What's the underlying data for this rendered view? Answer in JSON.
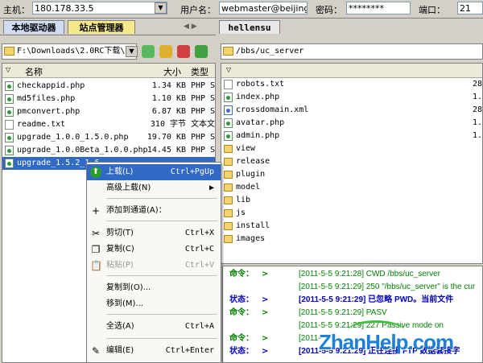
{
  "connection": {
    "host_label": "主机：",
    "host_value": "180.178.33.5",
    "user_label": "用户名：",
    "user_value": "webmaster@beijingn",
    "pass_label": "密码：",
    "pass_value": "********",
    "port_label": "端口：",
    "port_value": "21"
  },
  "tabs": {
    "local": "本地驱动器",
    "site_manager": "站点管理器",
    "remote": "hellensu"
  },
  "local_pane": {
    "path": "F:\\Downloads\\2.0RC下载\\U",
    "columns": {
      "name": "名称",
      "size": "大小",
      "type": "类型"
    },
    "files": [
      {
        "name": "checkappid.php",
        "size": "1.34 KB",
        "type": "PHP S",
        "icon": "php-file-icon"
      },
      {
        "name": "md5files.php",
        "size": "1.10 KB",
        "type": "PHP S",
        "icon": "php-file-icon"
      },
      {
        "name": "pmconvert.php",
        "size": "6.87 KB",
        "type": "PHP S",
        "icon": "php-file-icon"
      },
      {
        "name": "readme.txt",
        "size": "310 字节",
        "type": "文本文",
        "icon": "text-file-icon"
      },
      {
        "name": "upgrade_1.0.0_1.5.0.php",
        "size": "19.70 KB",
        "type": "PHP S",
        "icon": "php-file-icon"
      },
      {
        "name": "upgrade_1.0.0Beta_1.0.0.php",
        "size": "14.45 KB",
        "type": "PHP S",
        "icon": "php-file-icon"
      },
      {
        "name": "upgrade_1.5.2_1.6",
        "size": "",
        "type": "",
        "icon": "php-file-icon"
      }
    ]
  },
  "remote_pane": {
    "path": "/bbs/uc_server",
    "files": [
      {
        "name": "robots.txt",
        "size": "28",
        "icon": "text-file-icon"
      },
      {
        "name": "index.php",
        "size": "1.",
        "icon": "php-file-icon"
      },
      {
        "name": "crossdomain.xml",
        "size": "280",
        "icon": "xml-file-icon"
      },
      {
        "name": "avatar.php",
        "size": "1.",
        "icon": "php-file-icon"
      },
      {
        "name": "admin.php",
        "size": "1.",
        "icon": "php-file-icon"
      },
      {
        "name": "view",
        "size": "",
        "icon": "folder-icon"
      },
      {
        "name": "release",
        "size": "",
        "icon": "folder-icon"
      },
      {
        "name": "plugin",
        "size": "",
        "icon": "folder-icon"
      },
      {
        "name": "model",
        "size": "",
        "icon": "folder-icon"
      },
      {
        "name": "lib",
        "size": "",
        "icon": "folder-icon"
      },
      {
        "name": "js",
        "size": "",
        "icon": "folder-icon"
      },
      {
        "name": "install",
        "size": "",
        "icon": "folder-icon"
      },
      {
        "name": "images",
        "size": "",
        "icon": "folder-icon"
      }
    ]
  },
  "context_menu": [
    {
      "label": "上载(L)",
      "shortcut": "Ctrl+PgUp",
      "icon": "upload-arrow-icon",
      "state": "highlighted"
    },
    {
      "label": "高级上载(N)",
      "shortcut": "▶",
      "icon": "",
      "state": "normal"
    },
    {
      "label": "添加到通道(A)：",
      "shortcut": "",
      "icon": "plus-icon",
      "state": "normal"
    },
    {
      "label": "剪切(T)",
      "shortcut": "Ctrl+X",
      "icon": "scissors-icon",
      "state": "normal"
    },
    {
      "label": "复制(C)",
      "shortcut": "Ctrl+C",
      "icon": "copy-icon",
      "state": "normal"
    },
    {
      "label": "粘贴(P)",
      "shortcut": "Ctrl+V",
      "icon": "paste-icon",
      "state": "disabled"
    },
    {
      "label": "复制到(O)...",
      "shortcut": "",
      "icon": "",
      "state": "normal"
    },
    {
      "label": "移到(M)...",
      "shortcut": "",
      "icon": "",
      "state": "normal"
    },
    {
      "label": "全选(A)",
      "shortcut": "Ctrl+A",
      "icon": "",
      "state": "normal"
    },
    {
      "label": "编辑(E)",
      "shortcut": "Ctrl+Enter",
      "icon": "edit-icon",
      "state": "normal"
    }
  ],
  "log": [
    {
      "kind": "命令：",
      "arrow": ">",
      "msg": "[2011-5-5 9:21:28] CWD /bbs/uc_server",
      "style": "green"
    },
    {
      "kind": "",
      "arrow": "",
      "msg": "[2011-5-5 9:21:29] 250 \"/bbs/uc_server\" is the cur",
      "style": "green"
    },
    {
      "kind": "状态：",
      "arrow": ">",
      "msg": "[2011-5-5 9:21:29] 已忽略 PWD。当前文件",
      "style": "blue"
    },
    {
      "kind": "命令：",
      "arrow": ">",
      "msg": "[2011-5-5 9:21:29] PASV",
      "style": "green"
    },
    {
      "kind": "",
      "arrow": "",
      "msg": "[2011-5-5 9:21:29] 227 Passive mode on",
      "style": "green"
    },
    {
      "kind": "命令：",
      "arrow": ">",
      "msg": "[2011-",
      "style": "green"
    },
    {
      "kind": "状态：",
      "arrow": ">",
      "msg": "[2011-5-5 9:21:29] 正在连接 FTP 数据套接字",
      "style": "blue"
    }
  ],
  "watermark": "ZhanHelp.com",
  "colors": {
    "selection": "#316ac5",
    "cmd_green": "#008000",
    "status_blue": "#0000c0",
    "window_bg": "#d4d0c8"
  }
}
